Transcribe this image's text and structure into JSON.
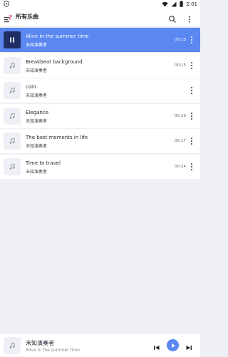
{
  "status_bar": {
    "time": "2:01",
    "icons": [
      "shield-icon",
      "wifi-icon",
      "signal-icon",
      "battery-icon"
    ]
  },
  "app_bar": {
    "title": "所有乐曲",
    "icons": [
      "menu-music-icon",
      "search-icon",
      "more-vert-icon"
    ]
  },
  "songs": [
    {
      "title": "Alive in the summer time",
      "artist": "未知演奏者",
      "duration": "00:13",
      "active": true,
      "show_duration": true
    },
    {
      "title": "Breakbeat background",
      "artist": "未知演奏者",
      "duration": "00:15",
      "active": false,
      "show_duration": true
    },
    {
      "title": "coin",
      "artist": "未知演奏者",
      "duration": "",
      "active": false,
      "show_duration": false
    },
    {
      "title": "Elegance",
      "artist": "未知演奏者",
      "duration": "00:29",
      "active": false,
      "show_duration": true
    },
    {
      "title": "The best moments in life",
      "artist": "未知演奏者",
      "duration": "00:17",
      "active": false,
      "show_duration": true
    },
    {
      "title": "Time to travel",
      "artist": "未知演奏者",
      "duration": "00:24",
      "active": false,
      "show_duration": true
    }
  ],
  "player": {
    "artist": "未知演奏者",
    "song": "Alive in the summer time",
    "icons": [
      "music-note-icon",
      "skip-previous-icon",
      "play-icon",
      "skip-next-icon"
    ]
  },
  "colors": {
    "accent": "#5a87f0",
    "active_thumb": "#1f2f66",
    "background": "#eef0f5"
  }
}
